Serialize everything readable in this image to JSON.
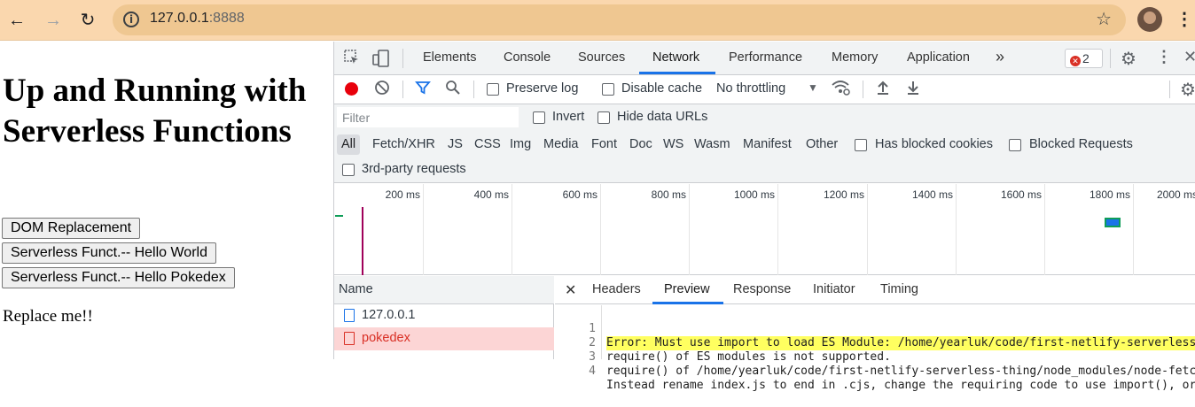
{
  "browser": {
    "url_host": "127.0.0.1",
    "url_port": ":8888"
  },
  "page": {
    "heading": "Up and Running with Serverless Functions",
    "buttons": [
      "DOM Replacement",
      "Serverless Funct.-- Hello World",
      "Serverless Funct.-- Hello Pokedex"
    ],
    "output_text": "Replace me!!"
  },
  "devtools": {
    "tabs": [
      "Elements",
      "Console",
      "Sources",
      "Network",
      "Performance",
      "Memory",
      "Application"
    ],
    "active_tab": "Network",
    "more_tabs": "»",
    "error_count": "2",
    "toolbar": {
      "preserve_log": "Preserve log",
      "disable_cache": "Disable cache",
      "throttling": "No throttling"
    },
    "filter": {
      "placeholder": "Filter",
      "invert": "Invert",
      "hide_data_urls": "Hide data URLs"
    },
    "type_filters": [
      "All",
      "Fetch/XHR",
      "JS",
      "CSS",
      "Img",
      "Media",
      "Font",
      "Doc",
      "WS",
      "Wasm",
      "Manifest",
      "Other"
    ],
    "has_blocked_cookies": "Has blocked cookies",
    "blocked_requests": "Blocked Requests",
    "third_party": "3rd-party requests",
    "timeline_ticks": [
      "200 ms",
      "400 ms",
      "600 ms",
      "800 ms",
      "1000 ms",
      "1200 ms",
      "1400 ms",
      "1600 ms",
      "1800 ms",
      "2000 ms"
    ],
    "requests_header": "Name",
    "requests": [
      {
        "name": "127.0.0.1",
        "status": "ok"
      },
      {
        "name": "pokedex",
        "status": "error"
      }
    ],
    "detail_tabs": [
      "Headers",
      "Preview",
      "Response",
      "Initiator",
      "Timing"
    ],
    "active_detail_tab": "Preview",
    "preview_lines": [
      {
        "n": "1",
        "text": "Error: Must use import to load ES Module: /home/yearluk/code/first-netlify-serverless-thing/",
        "highlight": true
      },
      {
        "n": "2",
        "text": "require() of ES modules is not supported.",
        "highlight": false
      },
      {
        "n": "3",
        "text": "require() of /home/yearluk/code/first-netlify-serverless-thing/node_modules/node-fetch/",
        "highlight": false
      },
      {
        "n": "4",
        "text": "Instead rename index.js to end in .cjs, change the requiring code to use import(), or",
        "highlight": false
      }
    ],
    "colors": {
      "accent": "#1a73e8",
      "record": "#e8000b",
      "error_row_bg": "#fcd5d5",
      "error_text": "#d93025",
      "highlight": "#ffff60"
    }
  }
}
